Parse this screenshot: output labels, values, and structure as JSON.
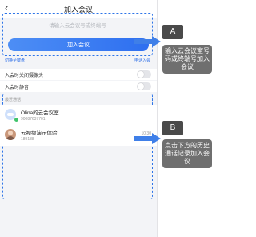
{
  "header": {
    "title": "加入会议",
    "back_icon": "chevron-left-icon"
  },
  "join": {
    "placeholder": "请输入云会议号或终端号",
    "button_label": "加入会议"
  },
  "links": {
    "left": "切换至键盘",
    "right": "电话入会"
  },
  "settings": [
    {
      "label": "入会时关闭摄像头",
      "on": false
    },
    {
      "label": "入会时静音",
      "on": false
    }
  ],
  "recent": {
    "header": "最近通话",
    "items": [
      {
        "name": "Olina的云会议室",
        "id": "90087637701",
        "time": "",
        "avatar": "cloud-meeting-icon"
      },
      {
        "name": "云视频演示体验",
        "id": "189188",
        "time": "10:30",
        "avatar": "person-avatar"
      }
    ]
  },
  "annotations": [
    {
      "label": "A",
      "text": "输入云会议室号码或终端号加入会议"
    },
    {
      "label": "B",
      "text": "点击下方的历史通话记录加入会议"
    }
  ],
  "colors": {
    "accent": "#2e6ff0",
    "dash": "#2d74e8",
    "callout_bg": "#6f6f6f",
    "label_bg": "#4a4a4a"
  }
}
